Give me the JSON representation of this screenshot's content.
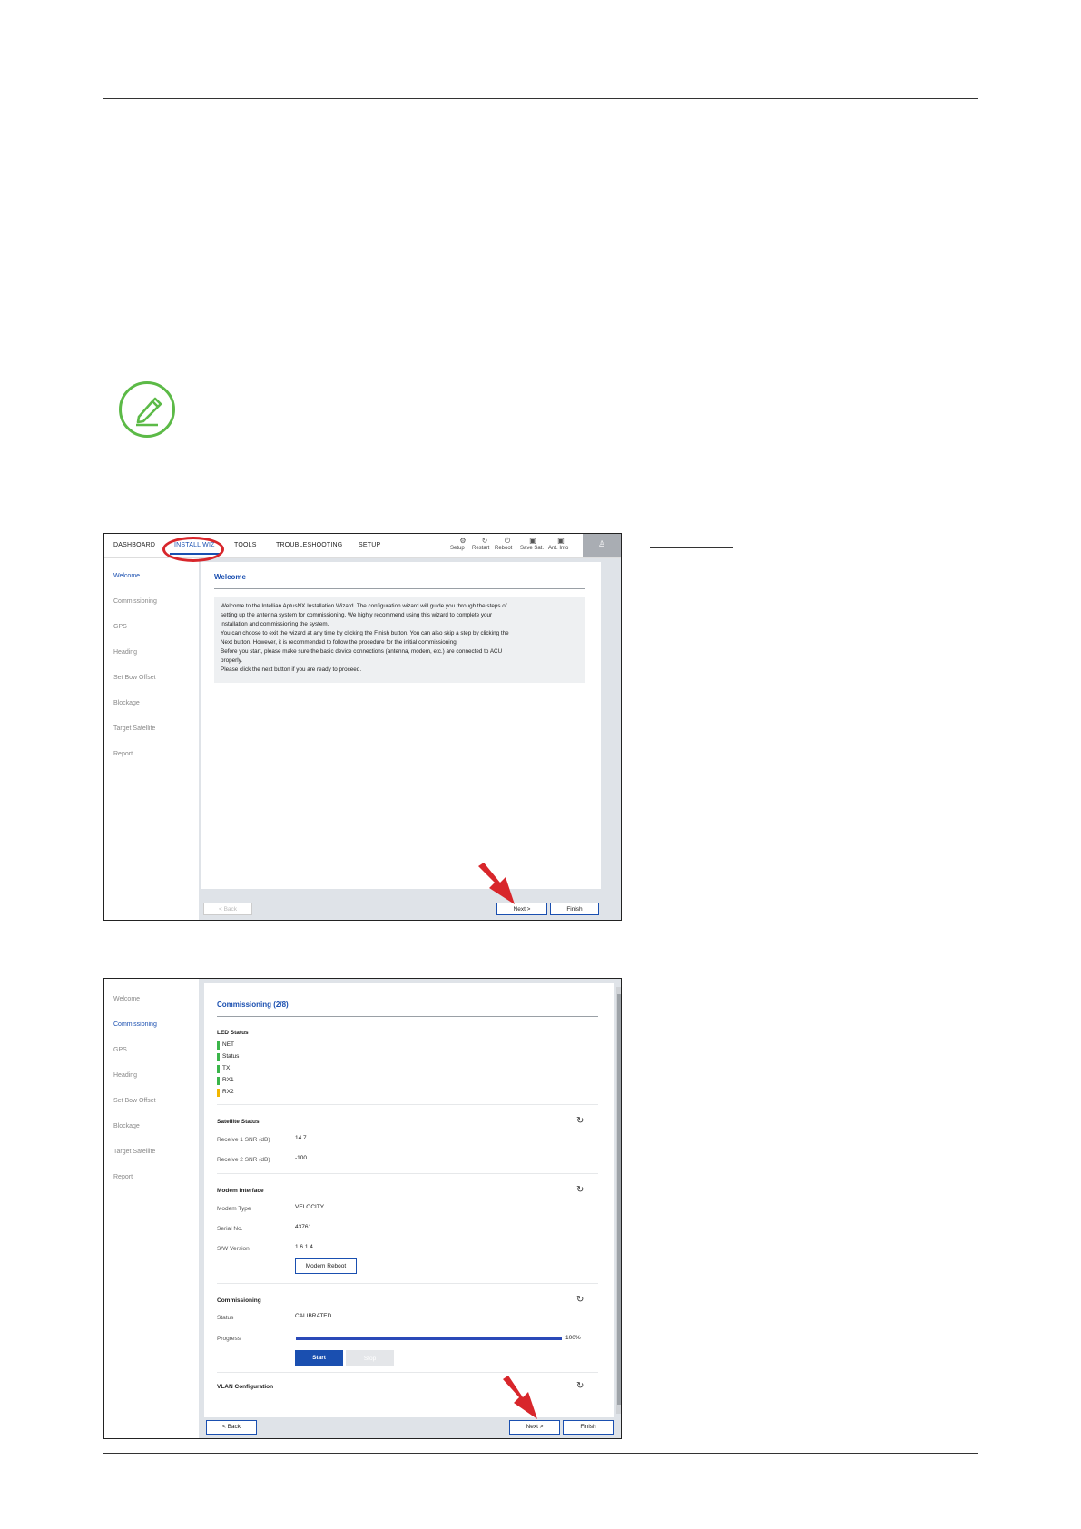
{
  "colors": {
    "accent": "#1a4fb0",
    "led_green": "#3bb54a",
    "led_yellow": "#f2b600",
    "highlight_red": "#d8262b",
    "note_green": "#5cba47"
  },
  "note_icon": "pencil-note-icon",
  "screenshot1": {
    "nav": [
      "DASHBOARD",
      "INSTALL WIZ",
      "TOOLS",
      "TROUBLESHOOTING",
      "SETUP"
    ],
    "toolbar": [
      {
        "icon": "gear-icon",
        "label": "Setup"
      },
      {
        "icon": "restart-icon",
        "label": "Restart"
      },
      {
        "icon": "power-icon",
        "label": "Reboot"
      },
      {
        "icon": "save-icon",
        "label": "Save Sat."
      },
      {
        "icon": "info-icon",
        "label": "Ant. Info"
      }
    ],
    "sidebar": [
      "Welcome",
      "Commissioning",
      "GPS",
      "Heading",
      "Set Bow Offset",
      "Blockage",
      "Target Satellite",
      "Report"
    ],
    "title": "Welcome",
    "message": [
      "Welcome to the Intellian AptusNX Installation Wizard. The configuration wizard will guide you through the steps of",
      "setting up the antenna system for commissioning. We highly recommend using this wizard to complete your",
      "installation and commissioning the system.",
      "You can choose to exit the wizard at any time by clicking the Finish button. You can also skip a step by clicking the",
      "Next button. However, it is recommended to follow the procedure for the initial commissioning.",
      "Before you start, please make sure the basic device connections (antenna, modem, etc.) are connected to ACU",
      "properly.",
      "Please click the next button if you are ready to proceed."
    ],
    "buttons": {
      "back": "< Back",
      "next": "Next >",
      "finish": "Finish"
    }
  },
  "screenshot2": {
    "sidebar": [
      "Welcome",
      "Commissioning",
      "GPS",
      "Heading",
      "Set Bow Offset",
      "Blockage",
      "Target Satellite",
      "Report"
    ],
    "title": "Commissioning (2/8)",
    "led_status": {
      "heading": "LED Status",
      "items": [
        {
          "label": "NET",
          "color": "#3bb54a"
        },
        {
          "label": "Status",
          "color": "#3bb54a"
        },
        {
          "label": "TX",
          "color": "#3bb54a"
        },
        {
          "label": "RX1",
          "color": "#3bb54a"
        },
        {
          "label": "RX2",
          "color": "#f2b600"
        }
      ]
    },
    "satellite_status": {
      "heading": "Satellite Status",
      "rows": [
        {
          "label": "Receive 1 SNR (dB)",
          "value": "14.7"
        },
        {
          "label": "Receive 2 SNR (dB)",
          "value": "-100"
        }
      ]
    },
    "modem_interface": {
      "heading": "Modem Interface",
      "rows": [
        {
          "label": "Modem Type",
          "value": "VELOCITY"
        },
        {
          "label": "Serial No.",
          "value": "43761"
        },
        {
          "label": "S/W Version",
          "value": "1.6.1.4"
        }
      ],
      "reboot_button": "Modem Reboot"
    },
    "commissioning": {
      "heading": "Commissioning",
      "status_label": "Status",
      "status_value": "CALIBRATED",
      "progress_label": "Progress",
      "progress_text": "100%",
      "progress_value": 1.0,
      "start_button": "Start",
      "stop_button": "Stop"
    },
    "vlan": {
      "heading": "VLAN Configuration"
    },
    "buttons": {
      "back": "< Back",
      "next": "Next >",
      "finish": "Finish"
    }
  }
}
